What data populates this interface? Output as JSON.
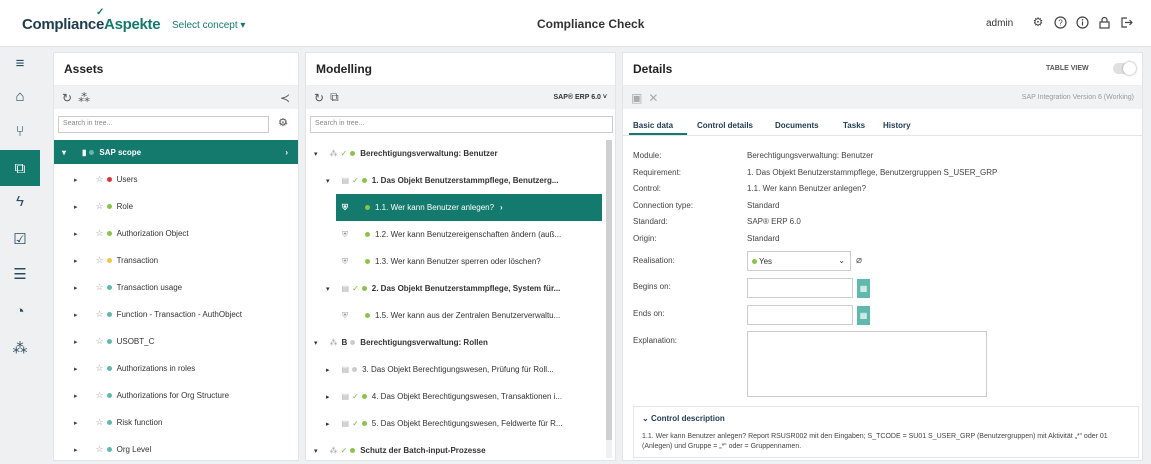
{
  "topbar": {
    "logo_a": "Compliance",
    "logo_b": "Aspekte",
    "concept": "Select concept ▾",
    "title": "Compliance Check",
    "user": "admin"
  },
  "assets": {
    "title": "Assets",
    "search_placeholder": "Search in tree...",
    "root": "SAP scope",
    "items": [
      {
        "label": "Users",
        "color": "#d9363e"
      },
      {
        "label": "Role",
        "color": "#8bc34a"
      },
      {
        "label": "Authorization Object",
        "color": "#8bc34a"
      },
      {
        "label": "Transaction",
        "color": "#f4c542"
      },
      {
        "label": "Transaction usage",
        "color": "#5fb9ae"
      },
      {
        "label": "Function - Transaction - AuthObject",
        "color": "#5fb9ae"
      },
      {
        "label": "USOBT_C",
        "color": "#5fb9ae"
      },
      {
        "label": "Authorizations in roles",
        "color": "#5fb9ae"
      },
      {
        "label": "Authorizations for Org Structure",
        "color": "#5fb9ae"
      },
      {
        "label": "Risk function",
        "color": "#5fb9ae"
      },
      {
        "label": "Org Level",
        "color": "#5fb9ae"
      }
    ]
  },
  "modelling": {
    "title": "Modelling",
    "standard_select": "SAP® ERP 6.0 ˅",
    "search_placeholder": "Search in tree...",
    "rows": [
      {
        "text": "Berechtigungsverwaltung: Benutzer",
        "bold": true,
        "indent": 0
      },
      {
        "text": "1. Das Objekt Benutzerstammpflege, Benutzerg...",
        "bold": true,
        "indent": 1
      },
      {
        "text": "1.1. Wer kann Benutzer anlegen?",
        "bold": false,
        "indent": 2,
        "selected": true
      },
      {
        "text": "1.2. Wer kann Benutzereigenschaften ändern (auß...",
        "bold": false,
        "indent": 2
      },
      {
        "text": "1.3. Wer kann Benutzer sperren oder löschen?",
        "bold": false,
        "indent": 2
      },
      {
        "text": "2. Das Objekt Benutzerstammpflege, System für...",
        "bold": true,
        "indent": 1
      },
      {
        "text": "1.5. Wer kann aus der Zentralen Benutzerverwaltu...",
        "bold": false,
        "indent": 2
      },
      {
        "text": "Berechtigungsverwaltung: Rollen",
        "bold": true,
        "indent": 0,
        "prefix": "B"
      },
      {
        "text": "3. Das Objekt Berechtigungswesen, Prüfung für Roll...",
        "bold": false,
        "indent": 1
      },
      {
        "text": "4. Das Objekt Berechtigungswesen, Transaktionen i...",
        "bold": false,
        "indent": 1
      },
      {
        "text": "5. Das Objekt Berechtigungswesen, Feldwerte für R...",
        "bold": false,
        "indent": 1
      },
      {
        "text": "Schutz der Batch-input-Prozesse",
        "bold": true,
        "indent": 0
      }
    ]
  },
  "details": {
    "title": "Details",
    "table_view": "TABLE VIEW",
    "version": "SAP Integration Version 6 (Working)",
    "tabs": [
      "Basic data",
      "Control details",
      "Documents",
      "Tasks",
      "History"
    ],
    "fields": [
      {
        "label": "Module:",
        "value": "Berechtigungsverwaltung: Benutzer"
      },
      {
        "label": "Requirement:",
        "value": "1. Das Objekt Benutzerstammpflege, Benutzergruppen S_USER_GRP"
      },
      {
        "label": "Control:",
        "value": "1.1. Wer kann Benutzer anlegen?"
      },
      {
        "label": "Connection type:",
        "value": "Standard"
      },
      {
        "label": "Standard:",
        "value": "SAP® ERP 6.0"
      },
      {
        "label": "Origin:",
        "value": "Standard"
      }
    ],
    "realisation_label": "Realisation:",
    "realisation_value": "Yes",
    "begins_label": "Begins on:",
    "ends_label": "Ends on:",
    "explanation_label": "Explanation:",
    "control_description_title": "Control description",
    "control_description_text": "1.1. Wer kann Benutzer anlegen? Report RSUSR002 mit den Eingaben; S_TCODE = SU01 S_USER_GRP (Benutzergruppen) mit Aktivität „*“ oder 01 (Anlegen) und Gruppe = „*“ oder = Gruppennamen."
  }
}
